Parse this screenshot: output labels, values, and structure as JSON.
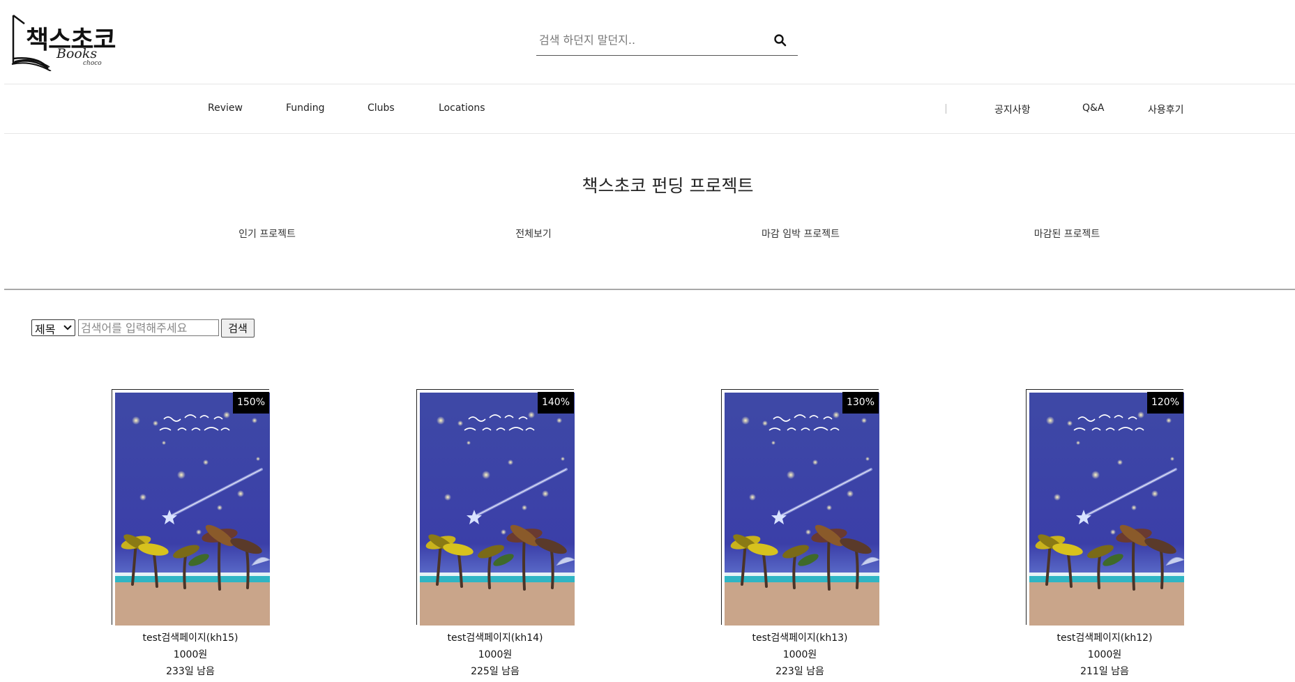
{
  "header": {
    "logo": {
      "main": "책스초코",
      "sub": "Books",
      "tiny": "choco"
    },
    "search": {
      "placeholder": "검색 하던지 말던지.."
    }
  },
  "nav": {
    "left": [
      "Review",
      "Funding",
      "Clubs",
      "Locations"
    ],
    "divider": "|",
    "right": [
      "공지사항",
      "Q&A",
      "사용후기"
    ]
  },
  "page": {
    "title": "책스초코 펀딩 프로젝트",
    "tabs": [
      "인기 프로젝트",
      "전체보기",
      "마감 임박 프로젝트",
      "마감된 프로젝트"
    ]
  },
  "filter": {
    "select_value": "제목",
    "input_placeholder": "검색어를 입력해주세요",
    "button_label": "검색"
  },
  "projects": [
    {
      "percent": "150%",
      "title": "test검색페이지(kh15)",
      "price": "1000원",
      "days_left": "233일 남음"
    },
    {
      "percent": "140%",
      "title": "test검색페이지(kh14)",
      "price": "1000원",
      "days_left": "225일 남음"
    },
    {
      "percent": "130%",
      "title": "test검색페이지(kh13)",
      "price": "1000원",
      "days_left": "223일 남음"
    },
    {
      "percent": "120%",
      "title": "test검색페이지(kh12)",
      "price": "1000원",
      "days_left": "211일 남음"
    }
  ],
  "colors": {
    "cover_sky": "#3b3fa8",
    "badge_bg": "#000000",
    "divider": "#a8a8a8"
  },
  "icons": {
    "search": "magnifier-icon",
    "select_caret": "chevron-down-icon"
  }
}
